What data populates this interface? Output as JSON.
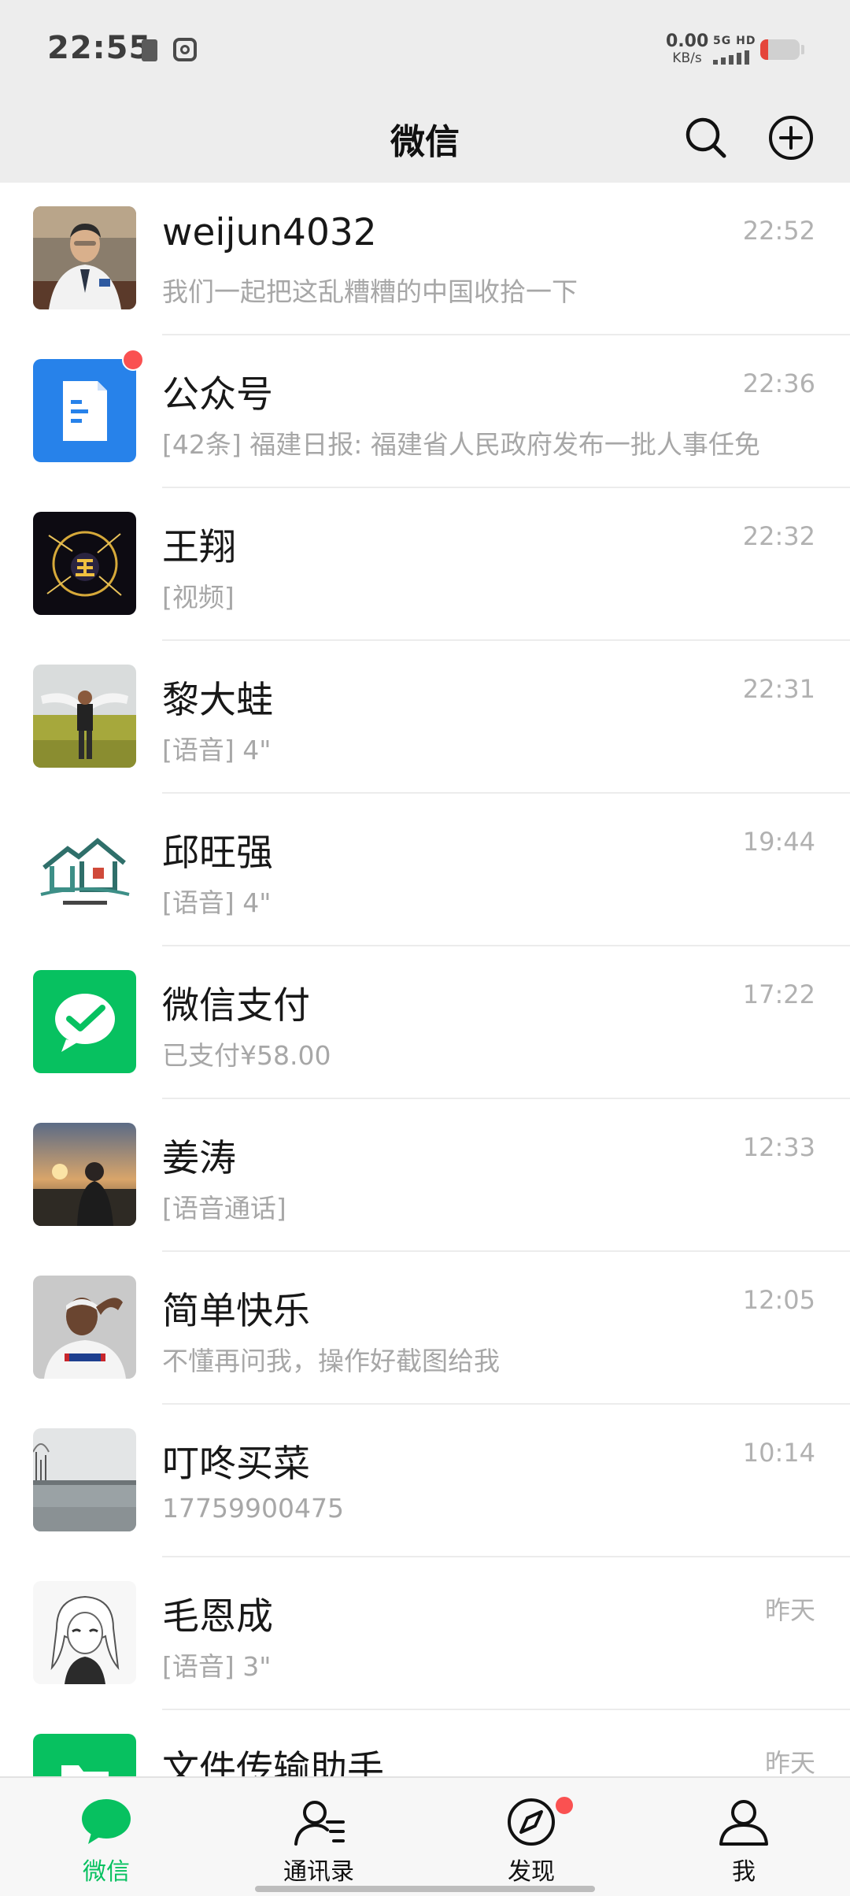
{
  "status_bar": {
    "time": "22:55",
    "net_speed_value": "0.00",
    "net_speed_unit": "KB/s",
    "network_type": "5G HD",
    "battery_level_fraction": 0.2,
    "battery_color": "#e5453b"
  },
  "header": {
    "title": "微信",
    "search_icon": "search-icon",
    "add_icon": "plus-circle-icon"
  },
  "chats": [
    {
      "name": "weijun4032",
      "preview": "我们一起把这乱糟糟的中国收拾一下",
      "time": "22:52",
      "avatar": "photo-portrait",
      "unread": false
    },
    {
      "name": "公众号",
      "preview": "[42条] 福建日报: 福建省人民政府发布一批人事任免",
      "time": "22:36",
      "avatar": "official-accounts-icon",
      "unread": true
    },
    {
      "name": "王翔",
      "preview": "[视频]",
      "time": "22:32",
      "avatar": "dark-logo",
      "unread": false
    },
    {
      "name": "黎大蛙",
      "preview": "[语音] 4\"",
      "time": "22:31",
      "avatar": "photo-field",
      "unread": false
    },
    {
      "name": "邱旺强",
      "preview": "[语音] 4\"",
      "time": "19:44",
      "avatar": "house-logo",
      "unread": false
    },
    {
      "name": "微信支付",
      "preview": "已支付¥58.00",
      "time": "17:22",
      "avatar": "wechat-pay-icon",
      "unread": false
    },
    {
      "name": "姜涛",
      "preview": "[语音通话]",
      "time": "12:33",
      "avatar": "photo-sunset",
      "unread": false
    },
    {
      "name": "简单快乐",
      "preview": "不懂再问我，操作好截图给我",
      "time": "12:05",
      "avatar": "photo-athlete",
      "unread": false
    },
    {
      "name": "叮咚买菜",
      "preview": "17759900475",
      "time": "10:14",
      "avatar": "photo-lake",
      "unread": false
    },
    {
      "name": "毛恩成",
      "preview": "[语音] 3\"",
      "time": "昨天",
      "avatar": "anime-sketch",
      "unread": false
    },
    {
      "name": "文件传输助手",
      "preview": "",
      "time": "昨天",
      "avatar": "file-transfer-icon",
      "unread": false
    }
  ],
  "nav": [
    {
      "label": "微信",
      "icon": "chat-bubble-icon",
      "active": true,
      "dot": false
    },
    {
      "label": "通讯录",
      "icon": "contacts-icon",
      "active": false,
      "dot": false
    },
    {
      "label": "发现",
      "icon": "compass-icon",
      "active": false,
      "dot": true
    },
    {
      "label": "我",
      "icon": "person-icon",
      "active": false,
      "dot": false
    }
  ],
  "colors": {
    "accent": "#07c160",
    "badge": "#fa5151",
    "header_bg": "#ededed",
    "preview_text": "#a7a7a7",
    "time_text": "#b1b1b1"
  }
}
